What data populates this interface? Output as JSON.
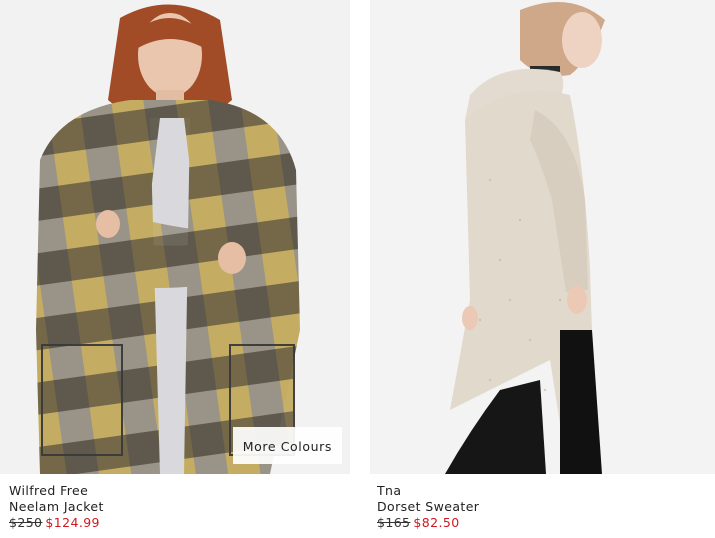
{
  "products": [
    {
      "brand": "Wilfred Free",
      "name": "Neelam Jacket",
      "price_original": "$250",
      "price_sale": "$124.99",
      "more_colours_label": "More Colours",
      "photo_desc": "model-plaid-coat"
    },
    {
      "brand": "Tna",
      "name": "Dorset Sweater",
      "price_original": "$165",
      "price_sale": "$82.50",
      "photo_desc": "model-oatmeal-hooded-cardigan"
    }
  ],
  "colors": {
    "sale_price": "#d0191e",
    "text": "#222222",
    "photo_background": "#f3f3f3"
  }
}
